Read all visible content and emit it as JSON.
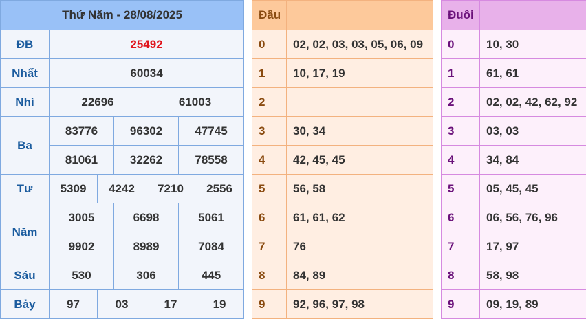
{
  "results": {
    "title": "Thứ Năm - 28/08/2025",
    "labels": {
      "db": "ĐB",
      "nhat": "Nhất",
      "nhi": "Nhì",
      "ba": "Ba",
      "tu": "Tư",
      "nam": "Năm",
      "sau": "Sáu",
      "bay": "Bảy"
    },
    "db": "25492",
    "nhat": "60034",
    "nhi": [
      "22696",
      "61003"
    ],
    "ba": [
      "83776",
      "96302",
      "47745",
      "81061",
      "32262",
      "78558"
    ],
    "tu": [
      "5309",
      "4242",
      "7210",
      "2556"
    ],
    "nam": [
      "3005",
      "6698",
      "5061",
      "9902",
      "8989",
      "7084"
    ],
    "sau": [
      "530",
      "306",
      "445"
    ],
    "bay": [
      "97",
      "03",
      "17",
      "19"
    ]
  },
  "dau": {
    "title": "Đầu",
    "rows": [
      {
        "d": "0",
        "v": "02, 02, 03, 03, 05, 06, 09"
      },
      {
        "d": "1",
        "v": "10, 17, 19"
      },
      {
        "d": "2",
        "v": ""
      },
      {
        "d": "3",
        "v": "30, 34"
      },
      {
        "d": "4",
        "v": "42, 45, 45"
      },
      {
        "d": "5",
        "v": "56, 58"
      },
      {
        "d": "6",
        "v": "61, 61, 62"
      },
      {
        "d": "7",
        "v": "76"
      },
      {
        "d": "8",
        "v": "84, 89"
      },
      {
        "d": "9",
        "v": "92, 96, 97, 98"
      }
    ]
  },
  "duoi": {
    "title": "Đuôi",
    "rows": [
      {
        "d": "0",
        "v": "10, 30"
      },
      {
        "d": "1",
        "v": "61, 61"
      },
      {
        "d": "2",
        "v": "02, 02, 42, 62, 92"
      },
      {
        "d": "3",
        "v": "03, 03"
      },
      {
        "d": "4",
        "v": "34, 84"
      },
      {
        "d": "5",
        "v": "05, 45, 45"
      },
      {
        "d": "6",
        "v": "06, 56, 76, 96"
      },
      {
        "d": "7",
        "v": "17, 97"
      },
      {
        "d": "8",
        "v": "58, 98"
      },
      {
        "d": "9",
        "v": "09, 19, 89"
      }
    ]
  }
}
